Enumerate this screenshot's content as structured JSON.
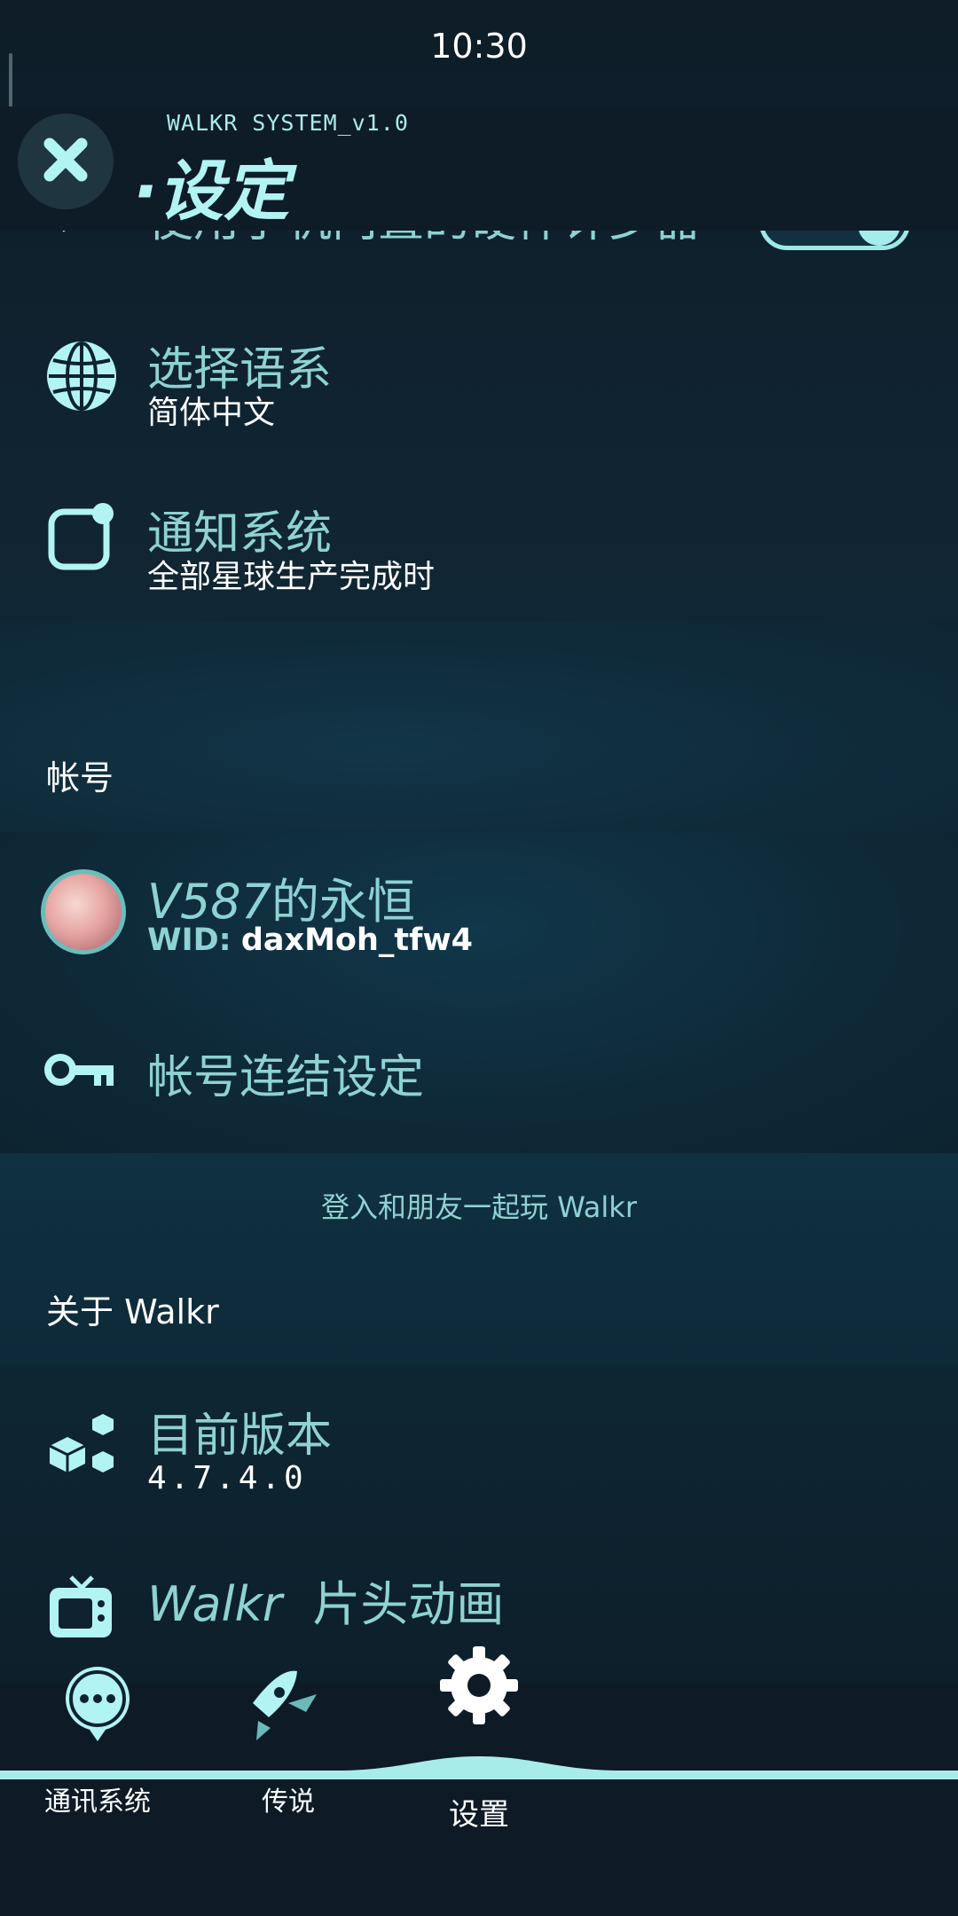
{
  "status_bar": {
    "time": "10:30"
  },
  "header": {
    "system_label": "WALKR SYSTEM_v1.0",
    "title": "·设定",
    "close_icon": "close-icon"
  },
  "partial_row": {
    "title": "使用手机内置的硬件计步器",
    "toggle_label": "On"
  },
  "settings": {
    "language": {
      "title": "选择语系",
      "value": "简体中文",
      "icon": "globe-icon"
    },
    "notifications": {
      "title": "通知系统",
      "value": "全部星球生产完成时",
      "icon": "notification-icon"
    }
  },
  "account": {
    "section_title": "帐号",
    "user": {
      "name_latin": "V587",
      "name_cjk": "的永恒",
      "wid_label": "WID:",
      "wid_value": "daxMoh_tfw4"
    },
    "link_settings": {
      "title": "帐号连结设定",
      "icon": "key-icon"
    },
    "login_hint": "登入和朋友一起玩 Walkr"
  },
  "about": {
    "section_title": "关于 Walkr",
    "version": {
      "title": "目前版本",
      "value": "4.7.4.0",
      "icon": "cubes-icon"
    },
    "intro_animation": {
      "title_latin": "Walkr",
      "title_cjk": "片头动画",
      "icon": "tv-icon"
    }
  },
  "bottom_nav": {
    "items": [
      {
        "label": "通讯系统",
        "icon": "chat-icon"
      },
      {
        "label": "传说",
        "icon": "rocket-icon"
      },
      {
        "label": "设置",
        "icon": "gear-icon",
        "active": true
      }
    ]
  },
  "colors": {
    "accent": "#a8ecea",
    "title_text": "#8ed2d2",
    "background": "#0f1f2a"
  }
}
